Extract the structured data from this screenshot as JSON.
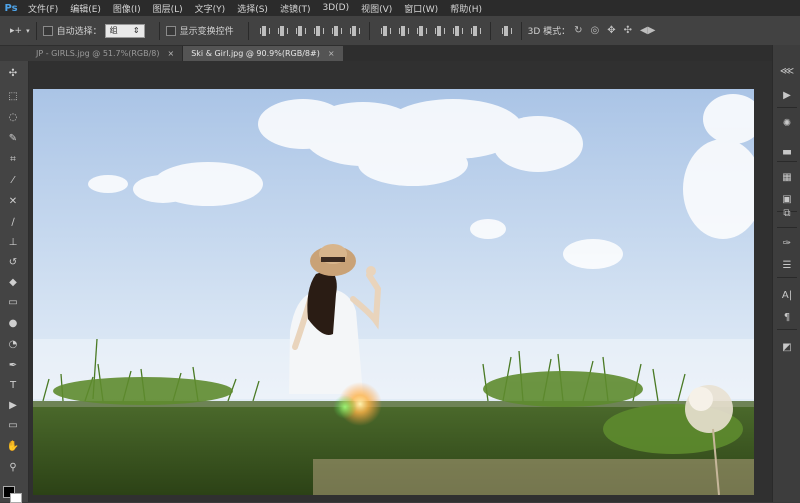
{
  "app": {
    "logo": "Ps"
  },
  "menu": [
    "文件(F)",
    "编辑(E)",
    "图像(I)",
    "图层(L)",
    "文字(Y)",
    "选择(S)",
    "滤镜(T)",
    "3D(D)",
    "视图(V)",
    "窗口(W)",
    "帮助(H)"
  ],
  "options": {
    "tool_glyph": "▸+",
    "auto_select_label": "自动选择：",
    "auto_select_value": "组",
    "show_transform_label": "显示变换控件",
    "mode_3d_label": "3D 模式："
  },
  "tabs": [
    {
      "label": "JP - GIRLS.jpg @ 51.7%(RGB/8)",
      "active": false,
      "close": "×"
    },
    {
      "label": "Ski & Girl.jpg @ 90.9%(RGB/8#)",
      "active": true,
      "close": "×"
    }
  ],
  "tool_icons": [
    "move-tool-icon",
    "marquee-tool-icon",
    "lasso-tool-icon",
    "quick-select-tool-icon",
    "crop-tool-icon",
    "eyedropper-tool-icon",
    "healing-brush-tool-icon",
    "brush-tool-icon",
    "clone-stamp-tool-icon",
    "history-brush-tool-icon",
    "eraser-tool-icon",
    "gradient-tool-icon",
    "blur-tool-icon",
    "dodge-tool-icon",
    "pen-tool-icon",
    "type-tool-icon",
    "path-select-tool-icon",
    "rectangle-tool-icon",
    "hand-tool-icon",
    "zoom-tool-icon"
  ],
  "colors": {
    "foreground": "#000000",
    "background": "#ffffff",
    "accent": "#4ea3e8"
  }
}
